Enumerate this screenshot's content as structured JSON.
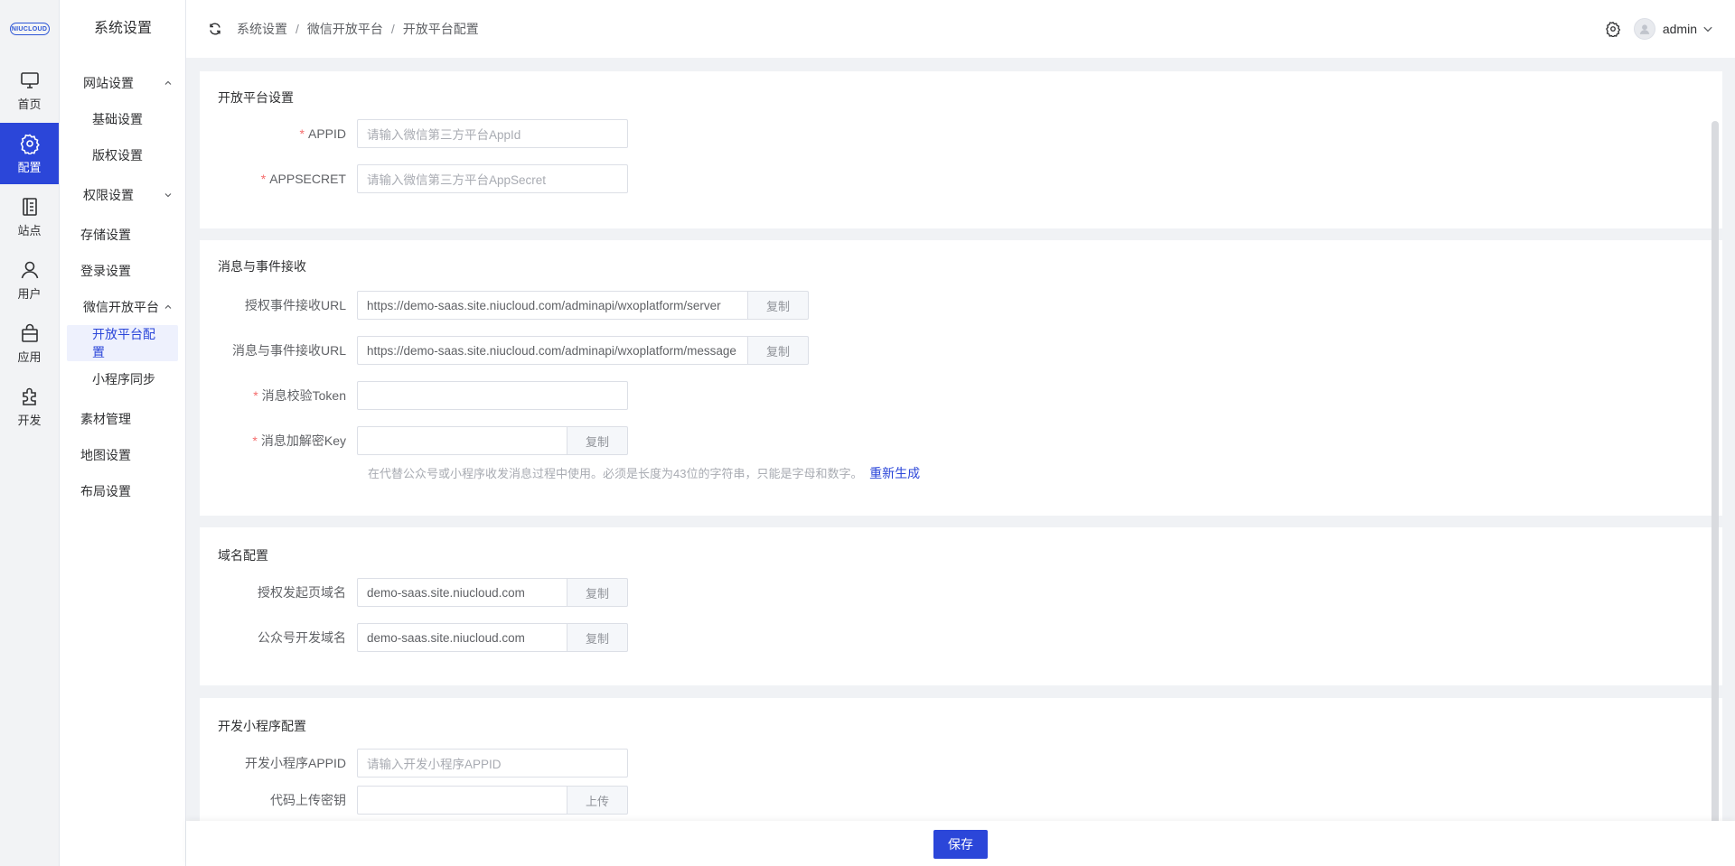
{
  "brand": {
    "logo_text": "NIUCLOUD"
  },
  "rail": [
    {
      "label": "首页",
      "icon": "monitor-icon",
      "active": false
    },
    {
      "label": "配置",
      "icon": "gear-icon",
      "active": true
    },
    {
      "label": "站点",
      "icon": "document-icon",
      "active": false
    },
    {
      "label": "用户",
      "icon": "user-icon",
      "active": false
    },
    {
      "label": "应用",
      "icon": "bag-icon",
      "active": false
    },
    {
      "label": "开发",
      "icon": "puzzle-icon",
      "active": false
    }
  ],
  "submenu": {
    "title": "系统设置",
    "items": [
      {
        "label": "网站设置",
        "kind": "group",
        "chevron": "up"
      },
      {
        "label": "基础设置",
        "kind": "sub"
      },
      {
        "label": "版权设置",
        "kind": "sub"
      },
      {
        "label": "权限设置",
        "kind": "group",
        "chevron": "down"
      },
      {
        "label": "存储设置",
        "kind": "plain"
      },
      {
        "label": "登录设置",
        "kind": "plain"
      },
      {
        "label": "微信开放平台",
        "kind": "group",
        "chevron": "up"
      },
      {
        "label": "开放平台配置",
        "kind": "sub",
        "active": true
      },
      {
        "label": "小程序同步",
        "kind": "sub"
      },
      {
        "label": "素材管理",
        "kind": "plain"
      },
      {
        "label": "地图设置",
        "kind": "plain"
      },
      {
        "label": "布局设置",
        "kind": "plain"
      }
    ]
  },
  "header": {
    "breadcrumbs": [
      "系统设置",
      "微信开放平台",
      "开放平台配置"
    ],
    "separator": "/",
    "username": "admin"
  },
  "sections": {
    "open_platform": {
      "title": "开放平台设置",
      "appid_label": "APPID",
      "appid_placeholder": "请输入微信第三方平台AppId",
      "secret_label": "APPSECRET",
      "secret_placeholder": "请输入微信第三方平台AppSecret"
    },
    "message": {
      "title": "消息与事件接收",
      "auth_url_label": "授权事件接收URL",
      "auth_url_value": "https://demo-saas.site.niucloud.com/adminapi/wxoplatform/server",
      "msg_url_label": "消息与事件接收URL",
      "msg_url_value": "https://demo-saas.site.niucloud.com/adminapi/wxoplatform/message",
      "token_label": "消息校验Token",
      "token_value": "",
      "key_label": "消息加解密Key",
      "key_value": "",
      "help_text": "在代替公众号或小程序收发消息过程中使用。必须是长度为43位的字符串，只能是字母和数字。",
      "regenerate": "重新生成",
      "copy": "复制"
    },
    "domain": {
      "title": "域名配置",
      "auth_domain_label": "授权发起页域名",
      "auth_domain_value": "demo-saas.site.niucloud.com",
      "mp_domain_label": "公众号开发域名",
      "mp_domain_value": "demo-saas.site.niucloud.com",
      "copy": "复制"
    },
    "miniprogram": {
      "title": "开发小程序配置",
      "appid_label": "开发小程序APPID",
      "appid_placeholder": "请输入开发小程序APPID",
      "key_label": "代码上传密钥",
      "key_value": "",
      "upload": "上传"
    }
  },
  "footer": {
    "save": "保存"
  },
  "colors": {
    "primary": "#2b46d9",
    "required": "#f56c6c"
  }
}
